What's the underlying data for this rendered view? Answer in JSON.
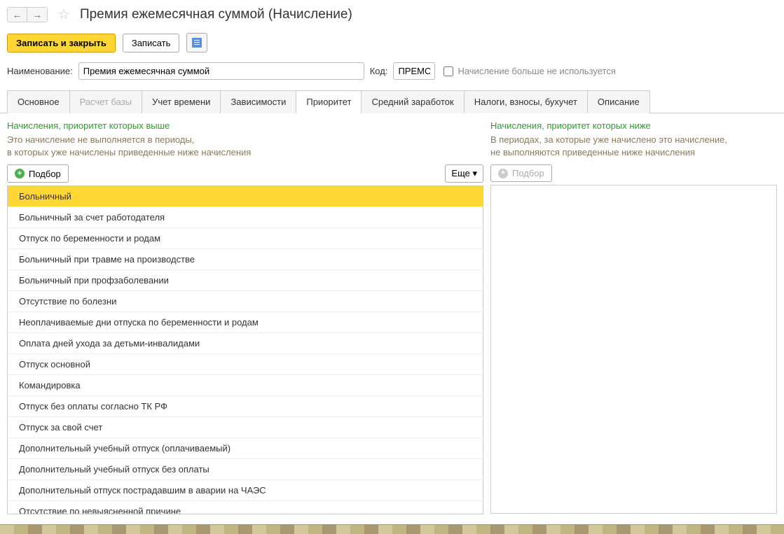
{
  "header": {
    "title": "Премия ежемесячная суммой (Начисление)"
  },
  "toolbar": {
    "save_close": "Записать и закрыть",
    "save": "Записать"
  },
  "form": {
    "name_label": "Наименование:",
    "name_value": "Премия ежемесячная суммой",
    "code_label": "Код:",
    "code_value": "ПРЕМС",
    "unused_label": "Начисление больше не используется"
  },
  "tabs": [
    {
      "label": "Основное",
      "id": "main"
    },
    {
      "label": "Расчет базы",
      "id": "base",
      "disabled": true
    },
    {
      "label": "Учет времени",
      "id": "time"
    },
    {
      "label": "Зависимости",
      "id": "deps"
    },
    {
      "label": "Приоритет",
      "id": "priority",
      "active": true
    },
    {
      "label": "Средний заработок",
      "id": "avg"
    },
    {
      "label": "Налоги, взносы, бухучет",
      "id": "tax"
    },
    {
      "label": "Описание",
      "id": "desc"
    }
  ],
  "panel_higher": {
    "title": "Начисления, приоритет которых выше",
    "desc_line1": "Это начисление не выполняется в периоды,",
    "desc_line2": "в которых уже начислены приведенные ниже начисления",
    "pick_label": "Подбор",
    "more_label": "Еще ▾",
    "items": [
      "Больничный",
      "Больничный за счет работодателя",
      "Отпуск по беременности и родам",
      "Больничный при травме на производстве",
      "Больничный при профзаболевании",
      "Отсутствие по болезни",
      "Неоплачиваемые дни отпуска по беременности и родам",
      "Оплата дней ухода за детьми-инвалидами",
      "Отпуск основной",
      "Командировка",
      "Отпуск без оплаты согласно ТК РФ",
      "Отпуск за свой счет",
      "Дополнительный учебный отпуск (оплачиваемый)",
      "Дополнительный учебный отпуск без оплаты",
      "Дополнительный отпуск пострадавшим в аварии на ЧАЭС",
      "Отсутствие по невыясненной причине"
    ],
    "selected_index": 0
  },
  "panel_lower": {
    "title": "Начисления, приоритет которых ниже",
    "desc_line1": "В периодах, за которые уже начислено это начисление,",
    "desc_line2": "не выполняются приведенные ниже начисления",
    "pick_label": "Подбор",
    "items": []
  }
}
